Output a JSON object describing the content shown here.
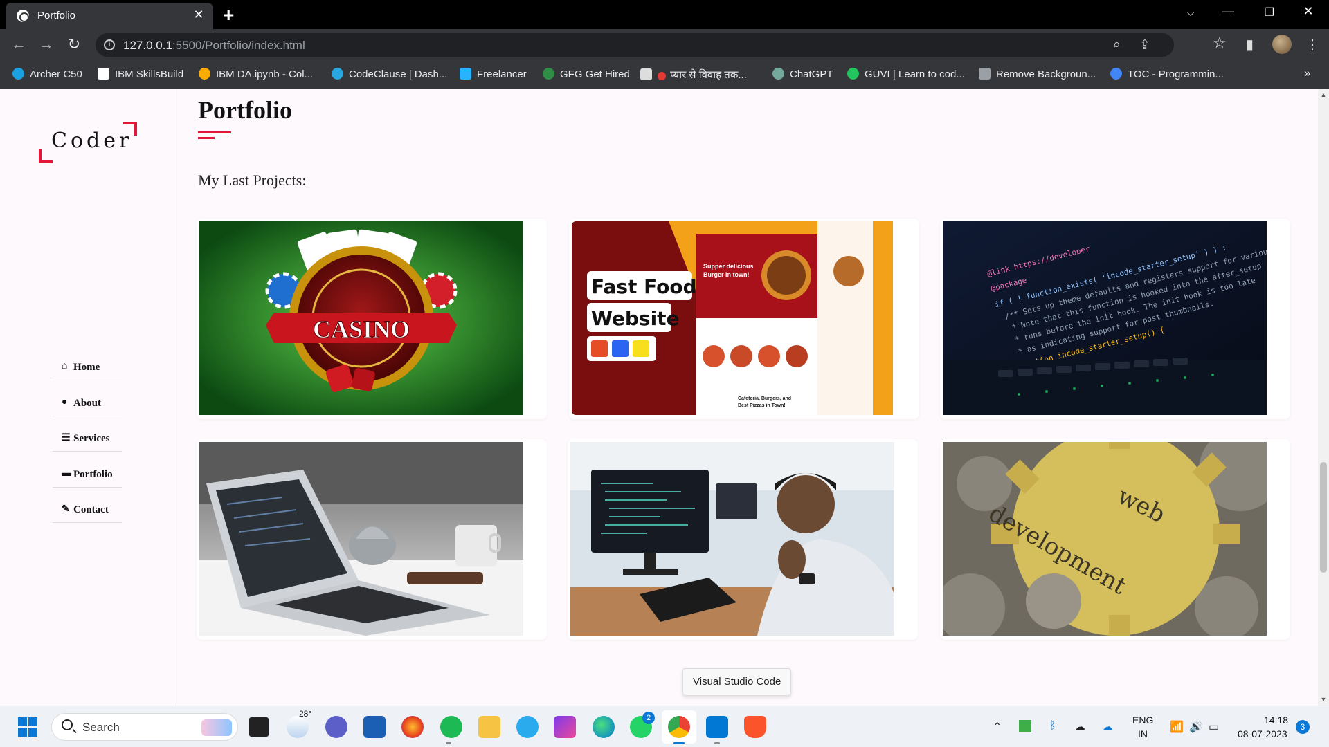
{
  "browser": {
    "tab_title": "Portfolio",
    "url_host": "127.0.0.1",
    "url_rest": ":5500/Portfolio/index.html",
    "bookmarks": [
      {
        "label": "Archer C50",
        "color": "#1ba1e2"
      },
      {
        "label": "IBM SkillsBuild",
        "color": "#ffffff"
      },
      {
        "label": "IBM DA.ipynb - Col...",
        "color": "#f9ab00"
      },
      {
        "label": "CodeClause | Dash...",
        "color": "#2aa7e0"
      },
      {
        "label": "Freelancer",
        "color": "#29b2fe"
      },
      {
        "label": "GFG Get Hired",
        "color": "#2f8d46"
      },
      {
        "label": "प्यार से विवाह तक...",
        "color": "#e53935"
      },
      {
        "label": "ChatGPT",
        "color": "#74aa9c"
      },
      {
        "label": "GUVI | Learn to cod...",
        "color": "#22c55e"
      },
      {
        "label": "Remove Backgroun...",
        "color": "#9aa0a6"
      },
      {
        "label": "TOC - Programmin...",
        "color": "#4285f4"
      }
    ]
  },
  "sidebar": {
    "logo_text": "Coder",
    "nav": [
      {
        "label": "Home",
        "icon": "home-icon"
      },
      {
        "label": "About",
        "icon": "user-icon"
      },
      {
        "label": "Services",
        "icon": "list-icon"
      },
      {
        "label": "Portfolio",
        "icon": "briefcase-icon"
      },
      {
        "label": "Contact",
        "icon": "comments-icon"
      }
    ]
  },
  "main": {
    "title": "Portfolio",
    "subtitle": "My Last Projects:",
    "projects": [
      {
        "name": "casino",
        "text": "CASINO"
      },
      {
        "name": "fast-food",
        "text_line1": "Fast Food",
        "text_line2": "Website"
      },
      {
        "name": "code-screen",
        "text": "@link https://developer"
      },
      {
        "name": "laptop-kettle"
      },
      {
        "name": "developer-at-desk"
      },
      {
        "name": "web-development",
        "text_line1": "web",
        "text_line2": "development"
      }
    ],
    "project_labels": {
      "fastfood_overlay_1": "Supper delicious Burger in town!",
      "fastfood_overlay_2": "Cafeteria, Burgers, and Best Pizzas in Town!",
      "code_lines": [
        "if ( ! function_exists( 'incode_starter_setup' ) ) :",
        "/** Sets up theme defaults and registers support for various WordPress",
        " * Note that this function is hooked into the after_setup_theme hook, which",
        " * runs before the init hook. The init hook is too late for some features,",
        " * as indicating support for post thumbnails."
      ]
    }
  },
  "tooltip": "Visual Studio Code",
  "taskbar": {
    "search_placeholder": "Search",
    "weather_temp": "28°",
    "whatsapp_badge": "2",
    "language_line1": "ENG",
    "language_line2": "IN",
    "time": "14:18",
    "date": "08-07-2023",
    "notification_count": "3"
  }
}
